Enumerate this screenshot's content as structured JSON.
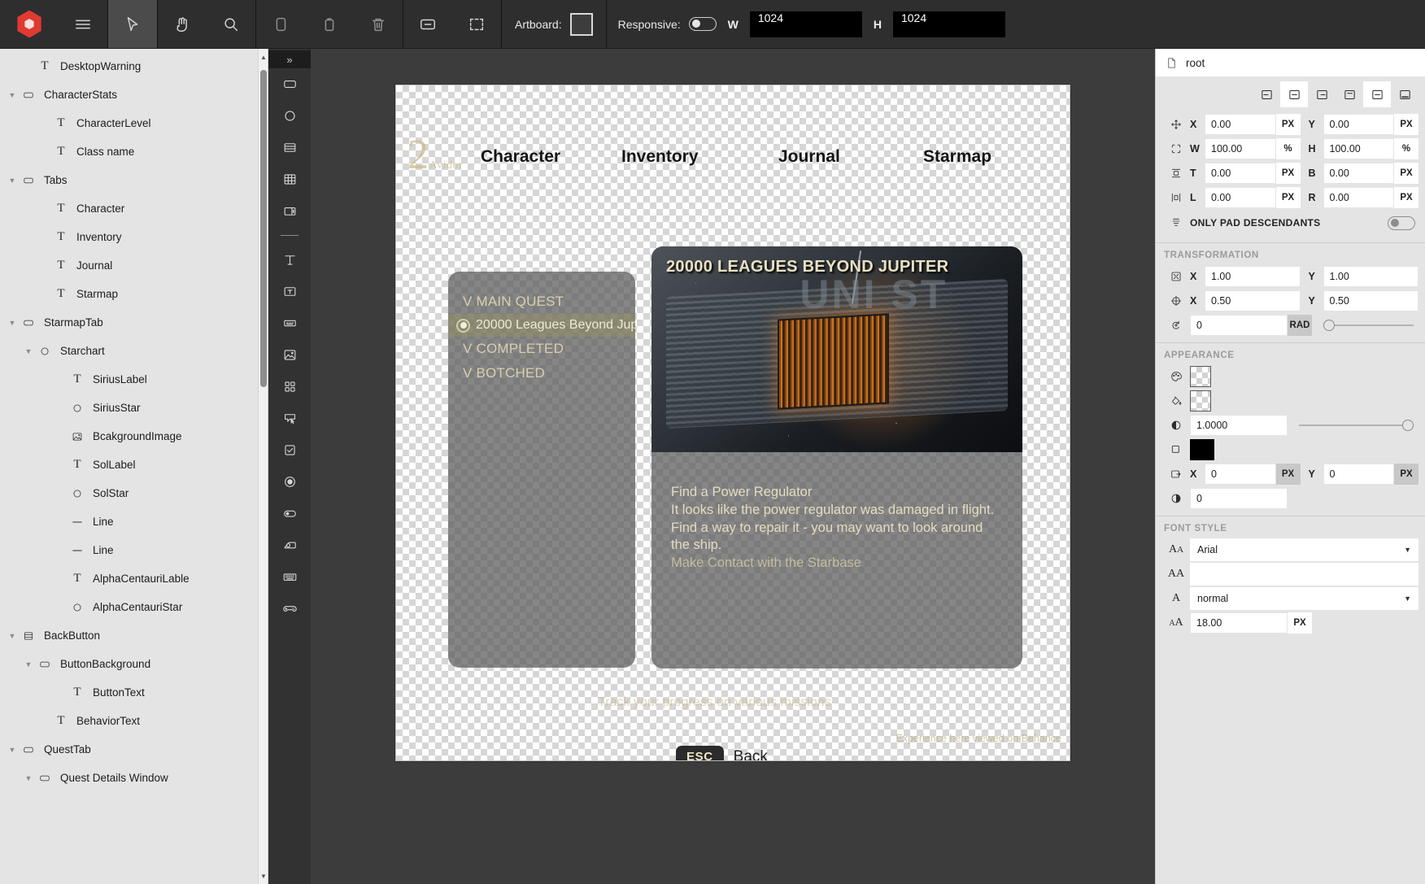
{
  "toolbar": {
    "logo_name": "app-logo",
    "tools": [
      {
        "name": "menu-icon",
        "label": "Menu",
        "active": false
      },
      {
        "name": "cursor-select-icon",
        "label": "Select",
        "active": true
      },
      {
        "name": "hand-pan-icon",
        "label": "Pan",
        "active": false
      },
      {
        "name": "search-icon",
        "label": "Search",
        "active": false
      },
      {
        "name": "copy-icon",
        "label": "Copy",
        "active": false
      },
      {
        "name": "paste-icon",
        "label": "Paste",
        "active": false
      },
      {
        "name": "trash-icon",
        "label": "Delete",
        "active": false
      },
      {
        "name": "fit-to-screen-icon",
        "label": "Fit to screen",
        "active": false
      },
      {
        "name": "marquee-select-icon",
        "label": "Marquee select",
        "active": false
      }
    ],
    "artboard_label": "Artboard:",
    "responsive_label": "Responsive:",
    "responsive_on": false,
    "w_label": "W",
    "w_value": "1024",
    "h_label": "H",
    "h_value": "1024"
  },
  "tree": {
    "items": [
      {
        "label": "DesktopWarning",
        "indent": 2,
        "icon": "text-layer-icon",
        "caret": "none"
      },
      {
        "label": "CharacterStats",
        "indent": 1,
        "icon": "frame-layer-icon",
        "caret": "open"
      },
      {
        "label": "CharacterLevel",
        "indent": 3,
        "icon": "text-layer-icon",
        "caret": "none"
      },
      {
        "label": "Class name",
        "indent": 3,
        "icon": "text-layer-icon",
        "caret": "none"
      },
      {
        "label": "Tabs",
        "indent": 1,
        "icon": "frame-layer-icon",
        "caret": "open"
      },
      {
        "label": "Character",
        "indent": 3,
        "icon": "text-layer-icon",
        "caret": "none"
      },
      {
        "label": "Inventory",
        "indent": 3,
        "icon": "text-layer-icon",
        "caret": "none"
      },
      {
        "label": "Journal",
        "indent": 3,
        "icon": "text-layer-icon",
        "caret": "none"
      },
      {
        "label": "Starmap",
        "indent": 3,
        "icon": "text-layer-icon",
        "caret": "none"
      },
      {
        "label": "StarmapTab",
        "indent": 1,
        "icon": "frame-layer-icon",
        "caret": "open"
      },
      {
        "label": "Starchart",
        "indent": 2,
        "icon": "ellipse-layer-icon",
        "caret": "open"
      },
      {
        "label": "SiriusLabel",
        "indent": 4,
        "icon": "text-layer-icon",
        "caret": "none"
      },
      {
        "label": "SiriusStar",
        "indent": 4,
        "icon": "ellipse-layer-icon",
        "caret": "none"
      },
      {
        "label": "BcakgroundImage",
        "indent": 4,
        "icon": "image-layer-icon",
        "caret": "none"
      },
      {
        "label": "SolLabel",
        "indent": 4,
        "icon": "text-layer-icon",
        "caret": "none"
      },
      {
        "label": "SolStar",
        "indent": 4,
        "icon": "ellipse-layer-icon",
        "caret": "none"
      },
      {
        "label": "Line",
        "indent": 4,
        "icon": "line-layer-icon",
        "caret": "none"
      },
      {
        "label": "Line",
        "indent": 4,
        "icon": "line-layer-icon",
        "caret": "none"
      },
      {
        "label": "AlphaCentauriLable",
        "indent": 4,
        "icon": "text-layer-icon",
        "caret": "none"
      },
      {
        "label": "AlphaCentauriStar",
        "indent": 4,
        "icon": "ellipse-layer-icon",
        "caret": "none"
      },
      {
        "label": "BackButton",
        "indent": 1,
        "icon": "stack-layer-icon",
        "caret": "open"
      },
      {
        "label": "ButtonBackground",
        "indent": 2,
        "icon": "frame-layer-icon",
        "caret": "open"
      },
      {
        "label": "ButtonText",
        "indent": 4,
        "icon": "text-layer-icon",
        "caret": "none"
      },
      {
        "label": "BehaviorText",
        "indent": 3,
        "icon": "text-layer-icon",
        "caret": "none"
      },
      {
        "label": "QuestTab",
        "indent": 1,
        "icon": "frame-layer-icon",
        "caret": "open"
      },
      {
        "label": "Quest Details Window",
        "indent": 2,
        "icon": "frame-layer-icon",
        "caret": "open"
      }
    ]
  },
  "tools_palette": {
    "expand_label": "»",
    "items": [
      {
        "name": "rectangle-tool-icon"
      },
      {
        "name": "ellipse-tool-icon"
      },
      {
        "name": "list-tool-icon"
      },
      {
        "name": "grid-tool-icon"
      },
      {
        "name": "split-panel-tool-icon"
      },
      {
        "name": "divider-tool-icon"
      },
      {
        "name": "text-tool-icon"
      },
      {
        "name": "text-input-tool-icon"
      },
      {
        "name": "text-area-tool-icon"
      },
      {
        "name": "image-tool-icon"
      },
      {
        "name": "icon-grid-tool-icon"
      },
      {
        "name": "button-tool-icon"
      },
      {
        "name": "checkbox-tool-icon"
      },
      {
        "name": "radio-tool-icon"
      },
      {
        "name": "toggle-tool-icon"
      },
      {
        "name": "slider-tool-icon"
      },
      {
        "name": "keyboard-tool-icon"
      },
      {
        "name": "gamepad-tool-icon"
      }
    ]
  },
  "canvas": {
    "game": {
      "logo_number": "2",
      "logo_word": "Avidor",
      "nav_tabs": [
        "Character",
        "Inventory",
        "Journal",
        "Starmap"
      ],
      "quest_list": {
        "main_quest_header": "V MAIN QUEST",
        "selected_quest": "20000 Leagues Beyond Jup",
        "completed_header": "V COMPLETED",
        "botched_header": "V BOTCHED"
      },
      "quest_detail": {
        "title": "20000 LEAGUES BEYOND JUPITER",
        "image_overlay_text": "UNI ST",
        "objective_title": "Find a Power Regulator",
        "objective_line1": "It looks like the power regulator was damaged in flight.",
        "objective_line2": "Find a way to repair it - you may want to look around",
        "objective_line3": "the ship.",
        "next_objective": "Make Contact with the Starbase"
      },
      "hint_text": "Track your progress on various missions",
      "esc_key": "ESC",
      "esc_label": "Back",
      "footnote": "Experience here viewed on Behance"
    }
  },
  "props": {
    "header_label": "root",
    "align_buttons": [
      {
        "name": "align-left-icon",
        "selected": false
      },
      {
        "name": "align-center-h-icon",
        "selected": true
      },
      {
        "name": "align-right-icon",
        "selected": false
      },
      {
        "name": "align-top-icon",
        "selected": false
      },
      {
        "name": "align-middle-v-icon",
        "selected": true
      },
      {
        "name": "align-bottom-icon",
        "selected": false
      }
    ],
    "layout": {
      "x_label": "X",
      "x_value": "0.00",
      "x_unit": "PX",
      "y_label": "Y",
      "y_value": "0.00",
      "y_unit": "PX",
      "w_label": "W",
      "w_value": "100.00",
      "w_unit": "%",
      "h_label": "H",
      "h_value": "100.00",
      "h_unit": "%",
      "t_label": "T",
      "t_value": "0.00",
      "t_unit": "PX",
      "b_label": "B",
      "b_value": "0.00",
      "b_unit": "PX",
      "l_label": "L",
      "l_value": "0.00",
      "l_unit": "PX",
      "r_label": "R",
      "r_value": "0.00",
      "r_unit": "PX",
      "only_pad_label": "ONLY PAD DESCENDANTS",
      "only_pad_on": false
    },
    "transformation": {
      "section_title": "TRANSFORMATION",
      "scale_x_label": "X",
      "scale_x_value": "1.00",
      "scale_y_label": "Y",
      "scale_y_value": "1.00",
      "origin_x_label": "X",
      "origin_x_value": "0.50",
      "origin_y_label": "Y",
      "origin_y_value": "0.50",
      "rotation_value": "0",
      "rotation_unit": "RAD",
      "rotation_slider_pct": 0
    },
    "appearance": {
      "section_title": "APPEARANCE",
      "fill_swatch": "transparent",
      "stroke_swatch": "transparent",
      "opacity_value": "1.0000",
      "opacity_slider_pct": 100,
      "shadow_color": "#000000",
      "shadow_x_label": "X",
      "shadow_x_value": "0",
      "shadow_x_unit": "PX",
      "shadow_y_label": "Y",
      "shadow_y_value": "0",
      "shadow_y_unit": "PX",
      "blur_value": "0"
    },
    "font_style": {
      "section_title": "FONT STYLE",
      "family_value": "Arial",
      "variant_value": "",
      "weight_value": "normal",
      "size_value": "18.00",
      "size_unit": "PX"
    }
  }
}
